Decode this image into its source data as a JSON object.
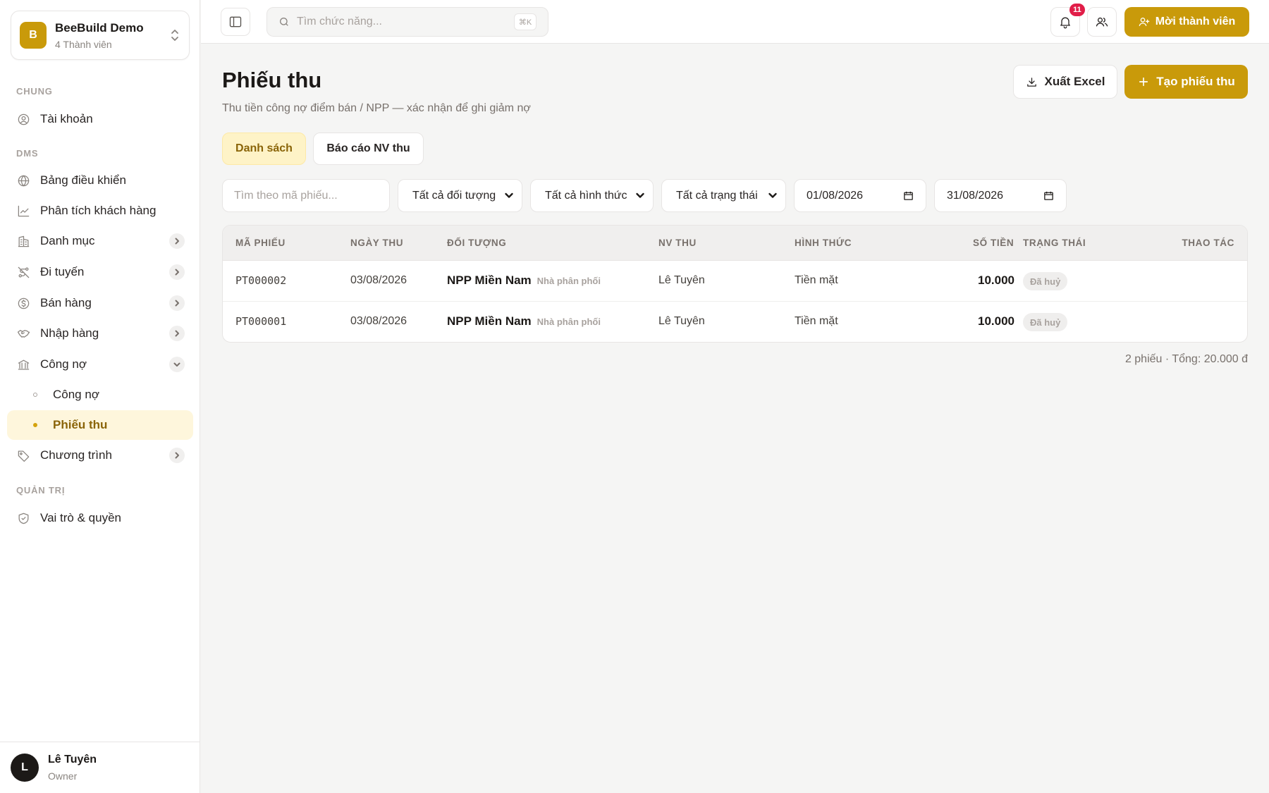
{
  "workspace": {
    "initial": "B",
    "name": "BeeBuild Demo",
    "members": "4 Thành viên"
  },
  "sidebar": {
    "sections": {
      "general": "CHUNG",
      "dms": "DMS",
      "admin": "QUẢN TRỊ"
    },
    "items": {
      "account": "Tài khoản",
      "dashboard": "Bảng điều khiển",
      "customer_analytics": "Phân tích khách hàng",
      "catalog": "Danh mục",
      "routes": "Đi tuyến",
      "sales": "Bán hàng",
      "purchasing": "Nhập hàng",
      "debt": "Công nợ",
      "debt_sub": "Công nợ",
      "receipts": "Phiếu thu",
      "programs": "Chương trình",
      "roles": "Vai trò & quyền"
    }
  },
  "user": {
    "initial": "L",
    "name": "Lê Tuyên",
    "role": "Owner"
  },
  "topbar": {
    "search_placeholder": "Tìm chức năng...",
    "shortcut": "⌘K",
    "notification_count": "11",
    "invite_label": "Mời thành viên"
  },
  "page": {
    "title": "Phiếu thu",
    "subtitle": "Thu tiền công nợ điểm bán / NPP — xác nhận để ghi giảm nợ",
    "export_label": "Xuất Excel",
    "create_label": "Tạo phiếu thu",
    "tabs": [
      "Danh sách",
      "Báo cáo NV thu"
    ],
    "active_tab": "Danh sách"
  },
  "filters": {
    "search_placeholder": "Tìm theo mã phiếu...",
    "object": "Tất cả đối tượng",
    "method": "Tất cả hình thức",
    "status": "Tất cả trạng thái",
    "date_from": "01/08/2026",
    "date_to": "31/08/2026"
  },
  "table": {
    "headers": [
      "MÃ PHIẾU",
      "NGÀY THU",
      "ĐỐI TƯỢNG",
      "NV THU",
      "HÌNH THỨC",
      "SỐ TIỀN",
      "TRẠNG THÁI",
      "THAO TÁC"
    ],
    "rows": [
      {
        "code": "PT000002",
        "date": "03/08/2026",
        "object": "NPP Miền Nam",
        "object_type": "Nhà phân phối",
        "collector": "Lê Tuyên",
        "method": "Tiền mặt",
        "amount": "10.000",
        "status": "Đã huỷ"
      },
      {
        "code": "PT000001",
        "date": "03/08/2026",
        "object": "NPP Miền Nam",
        "object_type": "Nhà phân phối",
        "collector": "Lê Tuyên",
        "method": "Tiền mặt",
        "amount": "10.000",
        "status": "Đã huỷ"
      }
    ]
  },
  "summary": "2 phiếu · Tổng: 20.000 đ",
  "colors": {
    "accent": "#c99a0a",
    "badge_red": "#e11d48",
    "active_bg": "#fef6dc"
  }
}
